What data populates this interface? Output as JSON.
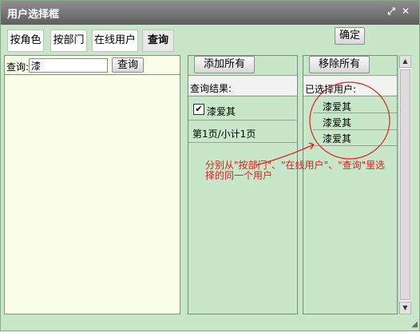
{
  "window": {
    "title": "用户选择框"
  },
  "tabs": [
    "按角色",
    "按部门",
    "在线用户",
    "查询"
  ],
  "confirm_label": "确定",
  "query": {
    "label": "查询:",
    "value": "漆",
    "button": "查询"
  },
  "middle": {
    "add_all": "添加所有",
    "result_label": "查询结果:",
    "result_item": "漆爱其",
    "pager": "第1页/小计1页"
  },
  "right": {
    "remove_all": "移除所有",
    "selected_label": "已选择用户:",
    "selected": [
      "漆爱其",
      "漆爱其",
      "漆爱其"
    ]
  },
  "annotation": {
    "line1": "分别从\"按部门\"、\"在线用户\"、\"查询\"里选",
    "line2": "择的同一个用户"
  },
  "colors": {
    "panel_bg": "#c8e6c8",
    "annotation": "#e02020"
  }
}
